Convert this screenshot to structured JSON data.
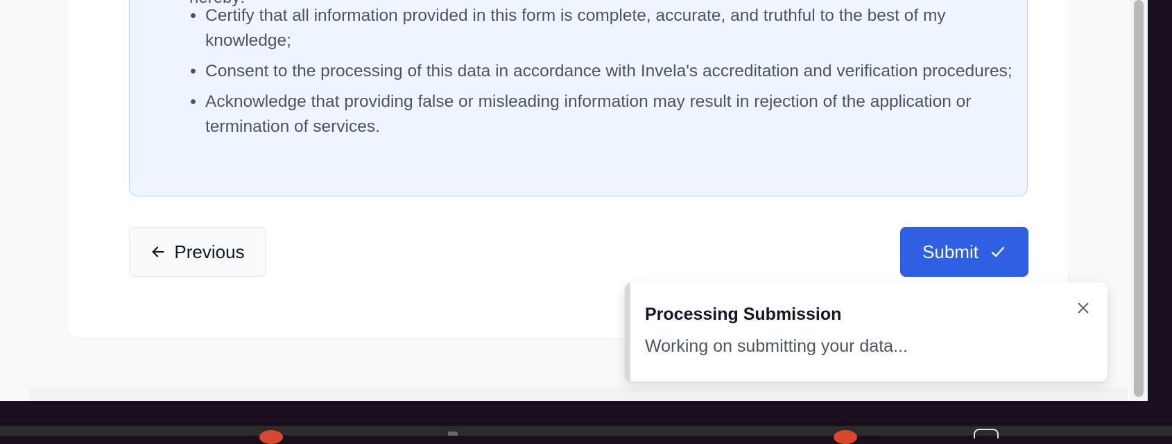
{
  "declaration": {
    "intro": "hereby:",
    "items": [
      "Certify that all information provided in this form is complete, accurate, and truthful to the best of my knowledge;",
      "Consent to the processing of this data in accordance with Invela's accreditation and verification procedures;",
      "Acknowledge that providing false or misleading information may result in rejection of the application or termination of services."
    ]
  },
  "buttons": {
    "previous_label": "Previous",
    "submit_label": "Submit"
  },
  "toast": {
    "title": "Processing Submission",
    "description": "Working on submitting your data..."
  },
  "icons": {
    "previous": "arrow-left-icon",
    "submit": "check-icon",
    "close": "close-icon"
  },
  "colors": {
    "primary": "#2f5fe3",
    "declaration_bg": "#eef5fe",
    "declaration_border": "#bcd6f3"
  }
}
